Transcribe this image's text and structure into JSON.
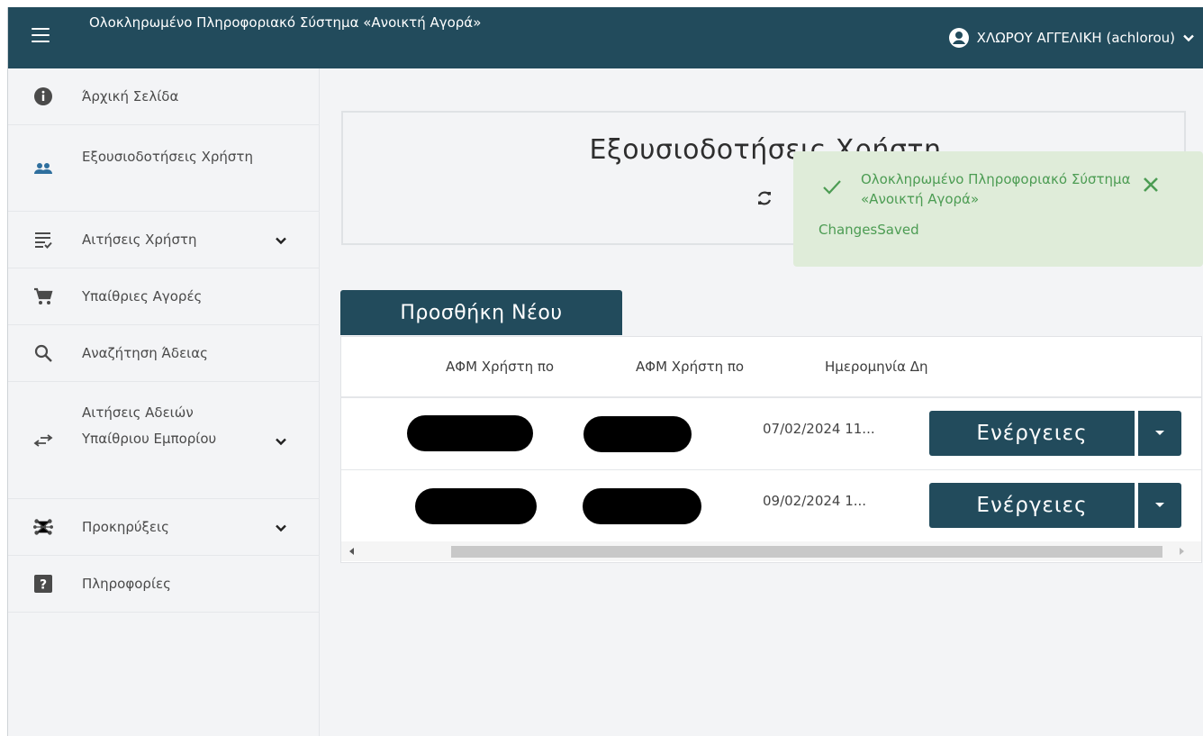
{
  "header": {
    "app_title": "Ολοκληρωμένο Πληροφοριακό Σύστημα «Ανοικτή Αγορά»",
    "user_label": "ΧΛΩΡΟΥ ΑΓΓΕΛΙΚΗ (achlorou)",
    "bar_color": "#224b5c",
    "icons": [
      "menu-icon",
      "user-circle-icon",
      "chevron-down-icon"
    ]
  },
  "sidebar": {
    "items": [
      {
        "label": "Άρχική Σελίδα",
        "icon": "info-icon",
        "expandable": false
      },
      {
        "label": "Εξουσιοδοτήσεις Χρήστη",
        "icon": "users-icon",
        "expandable": false
      },
      {
        "label": "Αιτήσεις Χρήστη",
        "icon": "list-check-icon",
        "expandable": true
      },
      {
        "label": "Υπαίθριες Αγορές",
        "icon": "cart-icon",
        "expandable": false
      },
      {
        "label": "Αναζήτηση Άδειας",
        "icon": "search-icon",
        "expandable": false
      },
      {
        "label": "Αιτήσεις Αδειών Υπαίθριου Εμπορίου",
        "icon": "swap-arrows-icon",
        "expandable": true
      },
      {
        "label": "Προκηρύξεις",
        "icon": "network-icon",
        "expandable": true
      },
      {
        "label": "Πληροφορίες",
        "icon": "question-icon",
        "expandable": false
      }
    ]
  },
  "main": {
    "page_title": "Εξουσιοδοτήσεις Χρήστη",
    "add_button": "Προσθήκη Νέου",
    "table": {
      "columns": [
        "ΑΦΜ Χρήστη πο",
        "ΑΦΜ Χρήστη πο",
        "Ημερομηνία Δη"
      ],
      "rows": [
        {
          "afm_1": "",
          "afm_2": "",
          "date": "07/02/2024 11...",
          "action": "Ενέργειες"
        },
        {
          "afm_1": "",
          "afm_2": "",
          "date": "09/02/2024 1...",
          "action": "Ενέργειες"
        }
      ]
    }
  },
  "toast": {
    "title": "Ολοκληρωμένο Πληροφοριακό Σύστημα «Ανοικτή Αγορά»",
    "message": "ChangesSaved",
    "status_color": "#4c9c53",
    "background": "#dfecd9"
  }
}
